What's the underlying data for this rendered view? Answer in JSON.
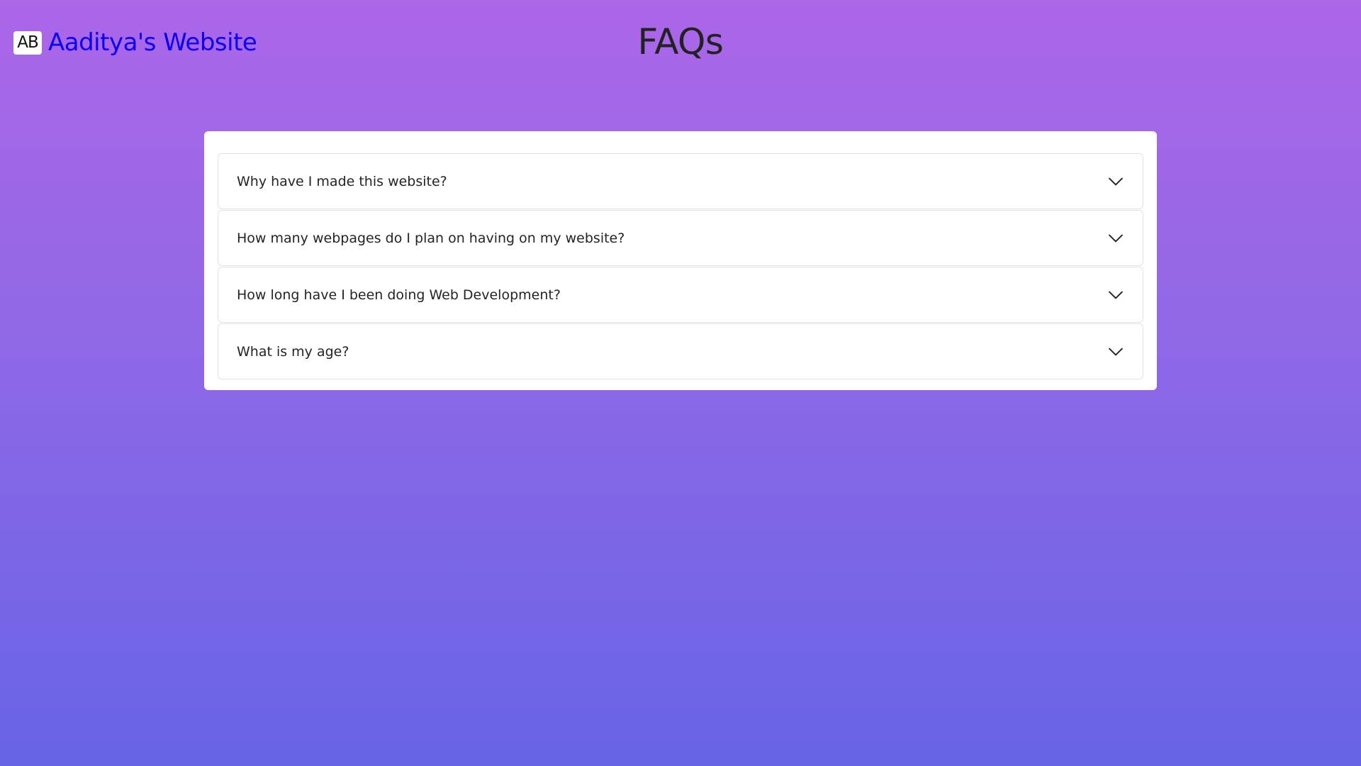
{
  "header": {
    "logo_badge": "AB",
    "site_name": "Aaditya's Website",
    "page_title": "FAQs"
  },
  "faq": {
    "items": [
      {
        "question": "Why have I made this website?",
        "icon": "chevron-down-icon"
      },
      {
        "question": "How many webpages do I plan on having on my website?",
        "icon": "chevron-down-icon"
      },
      {
        "question": "How long have I been doing Web Development?",
        "icon": "chevron-down-icon"
      },
      {
        "question": "What is my age?",
        "icon": "chevron-down-icon"
      }
    ]
  },
  "colors": {
    "background_top": "#ac66e8",
    "background_bottom": "#6764e6",
    "site_name": "#0b00f0",
    "title": "#222222",
    "card": "#ffffff"
  }
}
